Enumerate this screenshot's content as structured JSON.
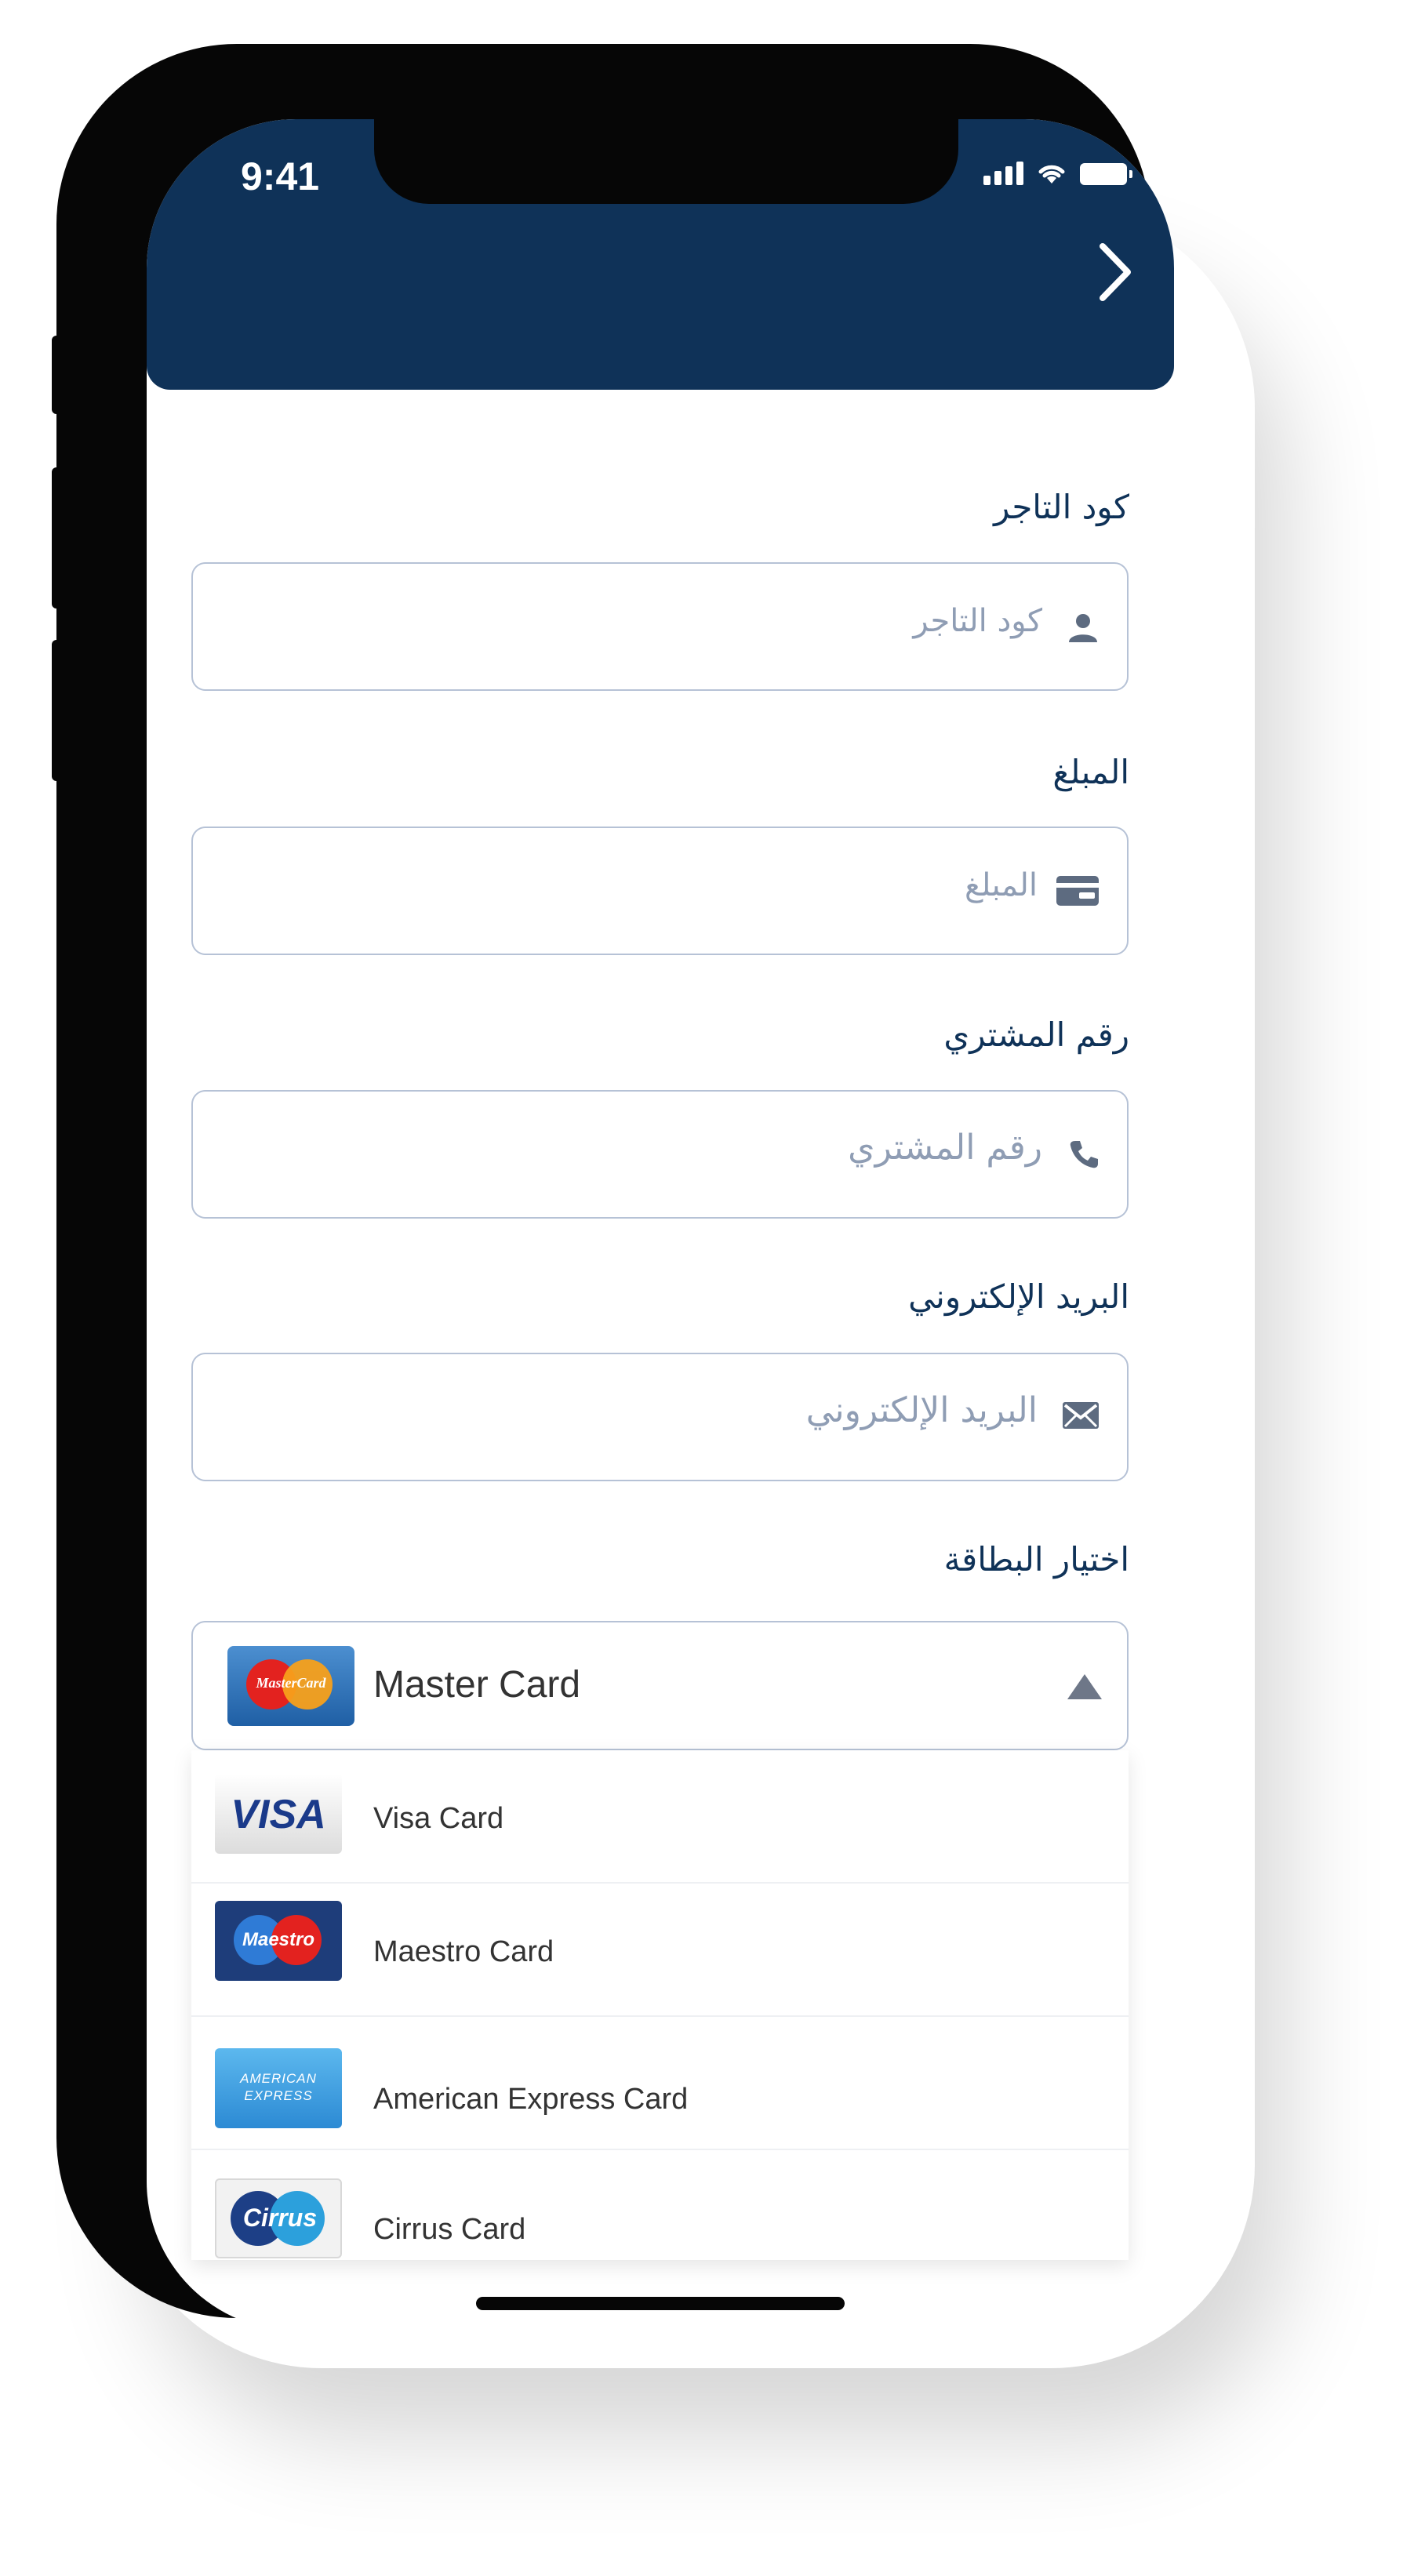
{
  "status_bar": {
    "time": "9:41"
  },
  "header": {
    "bg_color": "#0f3258",
    "forward_icon": "chevron-right-icon"
  },
  "form": {
    "fields": [
      {
        "label": "كود التاجر",
        "placeholder": "كود التاجر",
        "icon": "user-icon"
      },
      {
        "label": "المبلغ",
        "placeholder": "المبلغ",
        "icon": "card-icon"
      },
      {
        "label": "رقم المشتري",
        "placeholder": "رقم المشتري",
        "icon": "phone-icon"
      },
      {
        "label": "البريد الإلكتروني",
        "placeholder": "البريد الإلكتروني",
        "icon": "envelope-icon"
      }
    ],
    "card_select": {
      "label": "اختيار البطاقة",
      "selected": "Master Card",
      "options": [
        "Visa Card",
        "Maestro Card",
        "American Express Card",
        "Cirrus Card"
      ]
    }
  },
  "card_logos": {
    "mastercard": "MasterCard",
    "visa": "VISA",
    "maestro": "Maestro",
    "amex": [
      "AMERICAN",
      "EXPRESS"
    ],
    "cirrus": "Cirrus"
  }
}
